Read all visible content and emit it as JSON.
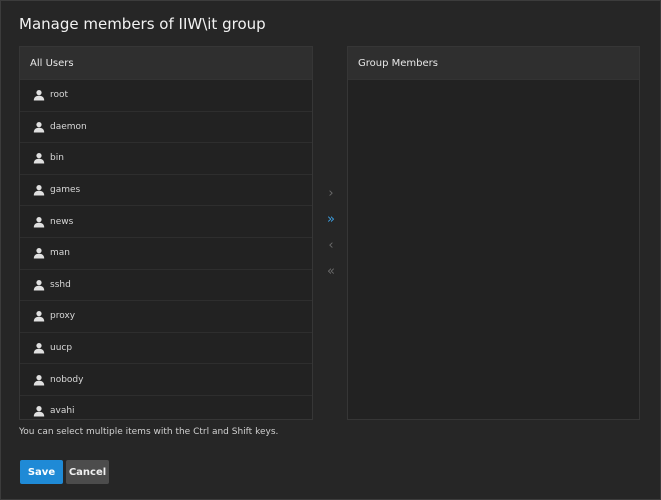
{
  "dialog": {
    "title": "Manage members of IIW\\it group",
    "hint": "You can select multiple items with the Ctrl and Shift keys."
  },
  "all_users": {
    "header": "All Users",
    "items": [
      "root",
      "daemon",
      "bin",
      "games",
      "news",
      "man",
      "sshd",
      "proxy",
      "uucp",
      "nobody",
      "avahi"
    ]
  },
  "group_members": {
    "header": "Group Members",
    "items": []
  },
  "transfer": {
    "move_selected": "›",
    "move_all": "»",
    "remove_selected": "‹",
    "remove_all": "«"
  },
  "buttons": {
    "save": "Save",
    "cancel": "Cancel"
  },
  "colors": {
    "accent": "#1f8ad6",
    "active_arrow": "#3d9ee0",
    "disabled_arrow": "#6a6a6a"
  }
}
